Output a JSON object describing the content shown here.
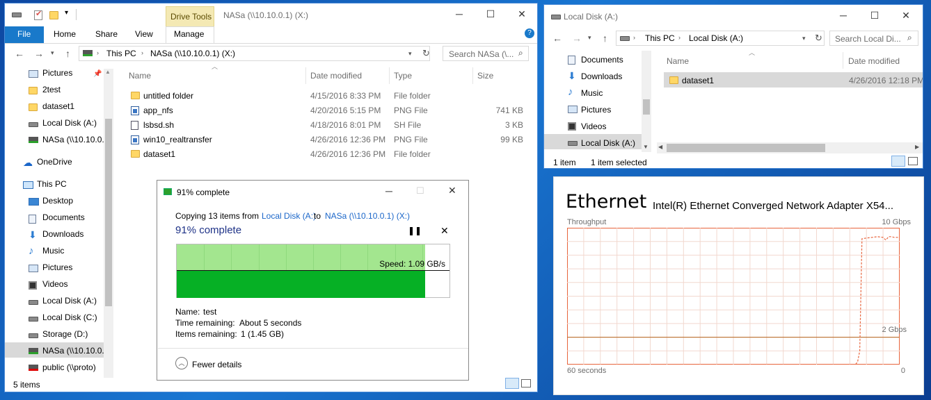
{
  "left": {
    "title": "NASa (\\\\10.10.0.1) (X:)",
    "context_tab": "Drive Tools",
    "ribbon_tabs": [
      "File",
      "Home",
      "Share",
      "View",
      "Manage"
    ],
    "address": [
      "This PC",
      "NASa (\\\\10.10.0.1) (X:)"
    ],
    "search_placeholder": "Search NASa (\\...",
    "columns": {
      "name": "Name",
      "date": "Date modified",
      "type": "Type",
      "size": "Size"
    },
    "files": [
      {
        "name": "untitled folder",
        "date": "4/15/2016 8:33 PM",
        "type": "File folder",
        "size": "",
        "icon": "folder-icon"
      },
      {
        "name": "app_nfs",
        "date": "4/20/2016 5:15 PM",
        "type": "PNG File",
        "size": "741 KB",
        "icon": "png-file-icon"
      },
      {
        "name": "lsbsd.sh",
        "date": "4/18/2016 8:01 PM",
        "type": "SH File",
        "size": "3 KB",
        "icon": "file-icon"
      },
      {
        "name": "win10_realtransfer",
        "date": "4/26/2016 12:36 PM",
        "type": "PNG File",
        "size": "99 KB",
        "icon": "png-file-icon"
      },
      {
        "name": "dataset1",
        "date": "4/26/2016 12:36 PM",
        "type": "File folder",
        "size": "",
        "icon": "folder-icon"
      }
    ],
    "nav": [
      {
        "label": "Pictures",
        "icon": "pictures-icon"
      },
      {
        "label": "2test",
        "icon": "folder-icon"
      },
      {
        "label": "dataset1",
        "icon": "folder-icon"
      },
      {
        "label": "Local Disk (A:)",
        "icon": "drive-icon"
      },
      {
        "label": "NASa (\\\\10.10.0.",
        "icon": "network-drive-icon"
      },
      {
        "label": "OneDrive",
        "icon": "onedrive-icon"
      },
      {
        "label": "This PC",
        "icon": "pc-icon"
      },
      {
        "label": "Desktop",
        "icon": "desktop-icon"
      },
      {
        "label": "Documents",
        "icon": "documents-icon"
      },
      {
        "label": "Downloads",
        "icon": "downloads-icon"
      },
      {
        "label": "Music",
        "icon": "music-icon"
      },
      {
        "label": "Pictures",
        "icon": "pictures-icon"
      },
      {
        "label": "Videos",
        "icon": "videos-icon"
      },
      {
        "label": "Local Disk (A:)",
        "icon": "drive-icon"
      },
      {
        "label": "Local Disk (C:)",
        "icon": "drive-icon"
      },
      {
        "label": "Storage (D:)",
        "icon": "drive-icon"
      },
      {
        "label": "NASa (\\\\10.10.0.",
        "icon": "network-drive-icon"
      },
      {
        "label": "public (\\\\proto)",
        "icon": "network-drive-error-icon"
      }
    ],
    "status": "5 items"
  },
  "copy": {
    "title": "91% complete",
    "desc_prefix": "Copying 13 items from ",
    "source": "Local Disk (A:)",
    "to": " to ",
    "dest": "NASa (\\\\10.10.0.1) (X:)",
    "heading": "91% complete",
    "progress": 0.91,
    "speed": "Speed: 1.09 GB/s",
    "name_label": "Name:",
    "name_value": "test",
    "time_label": "Time remaining:",
    "time_value": "About 5 seconds",
    "items_label": "Items remaining:",
    "items_value": "1 (1.45 GB)",
    "fewer": "Fewer details"
  },
  "right": {
    "title": "Local Disk (A:)",
    "address": [
      "This PC",
      "Local Disk (A:)"
    ],
    "search_placeholder": "Search Local Di...",
    "columns": {
      "name": "Name",
      "date": "Date modified"
    },
    "files": [
      {
        "name": "dataset1",
        "date": "4/26/2016 12:18 PM"
      }
    ],
    "nav": [
      {
        "label": "Documents",
        "icon": "documents-icon"
      },
      {
        "label": "Downloads",
        "icon": "downloads-icon"
      },
      {
        "label": "Music",
        "icon": "music-icon"
      },
      {
        "label": "Pictures",
        "icon": "pictures-icon"
      },
      {
        "label": "Videos",
        "icon": "videos-icon"
      },
      {
        "label": "Local Disk (A:)",
        "icon": "drive-icon"
      }
    ],
    "status_items": "1 item",
    "status_selected": "1 item selected"
  },
  "perf": {
    "title": "Ethernet",
    "adapter": "Intel(R) Ethernet Converged Network Adapter X54...",
    "throughput_label": "Throughput",
    "max_label": "10 Gbps",
    "mark_label": "2 Gbps",
    "left_label": "60 seconds",
    "right_label": "0",
    "line_color": "#e8643c"
  },
  "chart_data": {
    "type": "line",
    "title": "Throughput",
    "xlabel": "",
    "ylabel": "",
    "xlim": [
      60,
      0
    ],
    "ylim": [
      0,
      10
    ],
    "series": [
      {
        "x": [
          60,
          8,
          7.6,
          7.2,
          6.8,
          6,
          5,
          4,
          3,
          2.5,
          2,
          1.5,
          1,
          0
        ],
        "values": [
          0,
          0,
          0.2,
          1,
          9.2,
          9.25,
          9.3,
          9.35,
          9.3,
          9.1,
          9.35,
          9.35,
          9.3,
          9.3
        ]
      }
    ]
  }
}
